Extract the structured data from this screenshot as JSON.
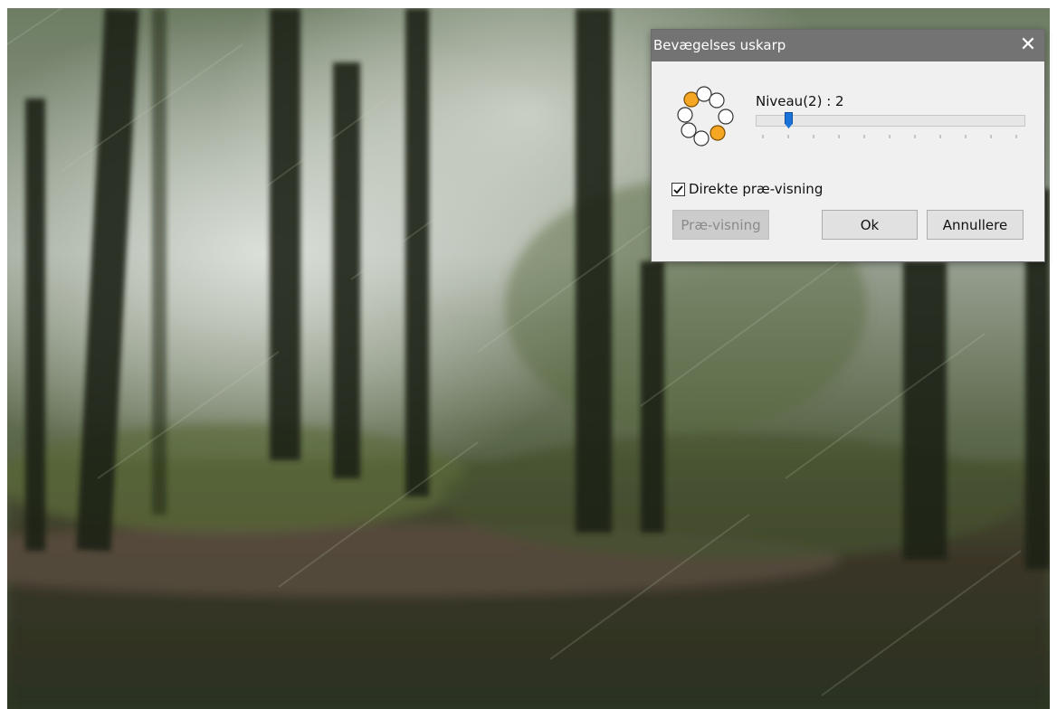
{
  "dialog": {
    "title": "Bevægelses uskarp",
    "close_glyph": "✕",
    "level_label": "Niveau(2) : 2",
    "slider": {
      "min": 0,
      "max": 20,
      "value": 2
    },
    "direct_preview": {
      "label": "Direkte præ-visning",
      "checked": true
    },
    "buttons": {
      "preview": "Præ-visning",
      "ok": "Ok",
      "cancel": "Annullere"
    },
    "icon": "motion-blur-icon"
  },
  "colors": {
    "titlebar": "#737373",
    "dialog_bg": "#f0f0f0",
    "accent_orange": "#f5a623",
    "slider_thumb": "#1a73d9"
  }
}
